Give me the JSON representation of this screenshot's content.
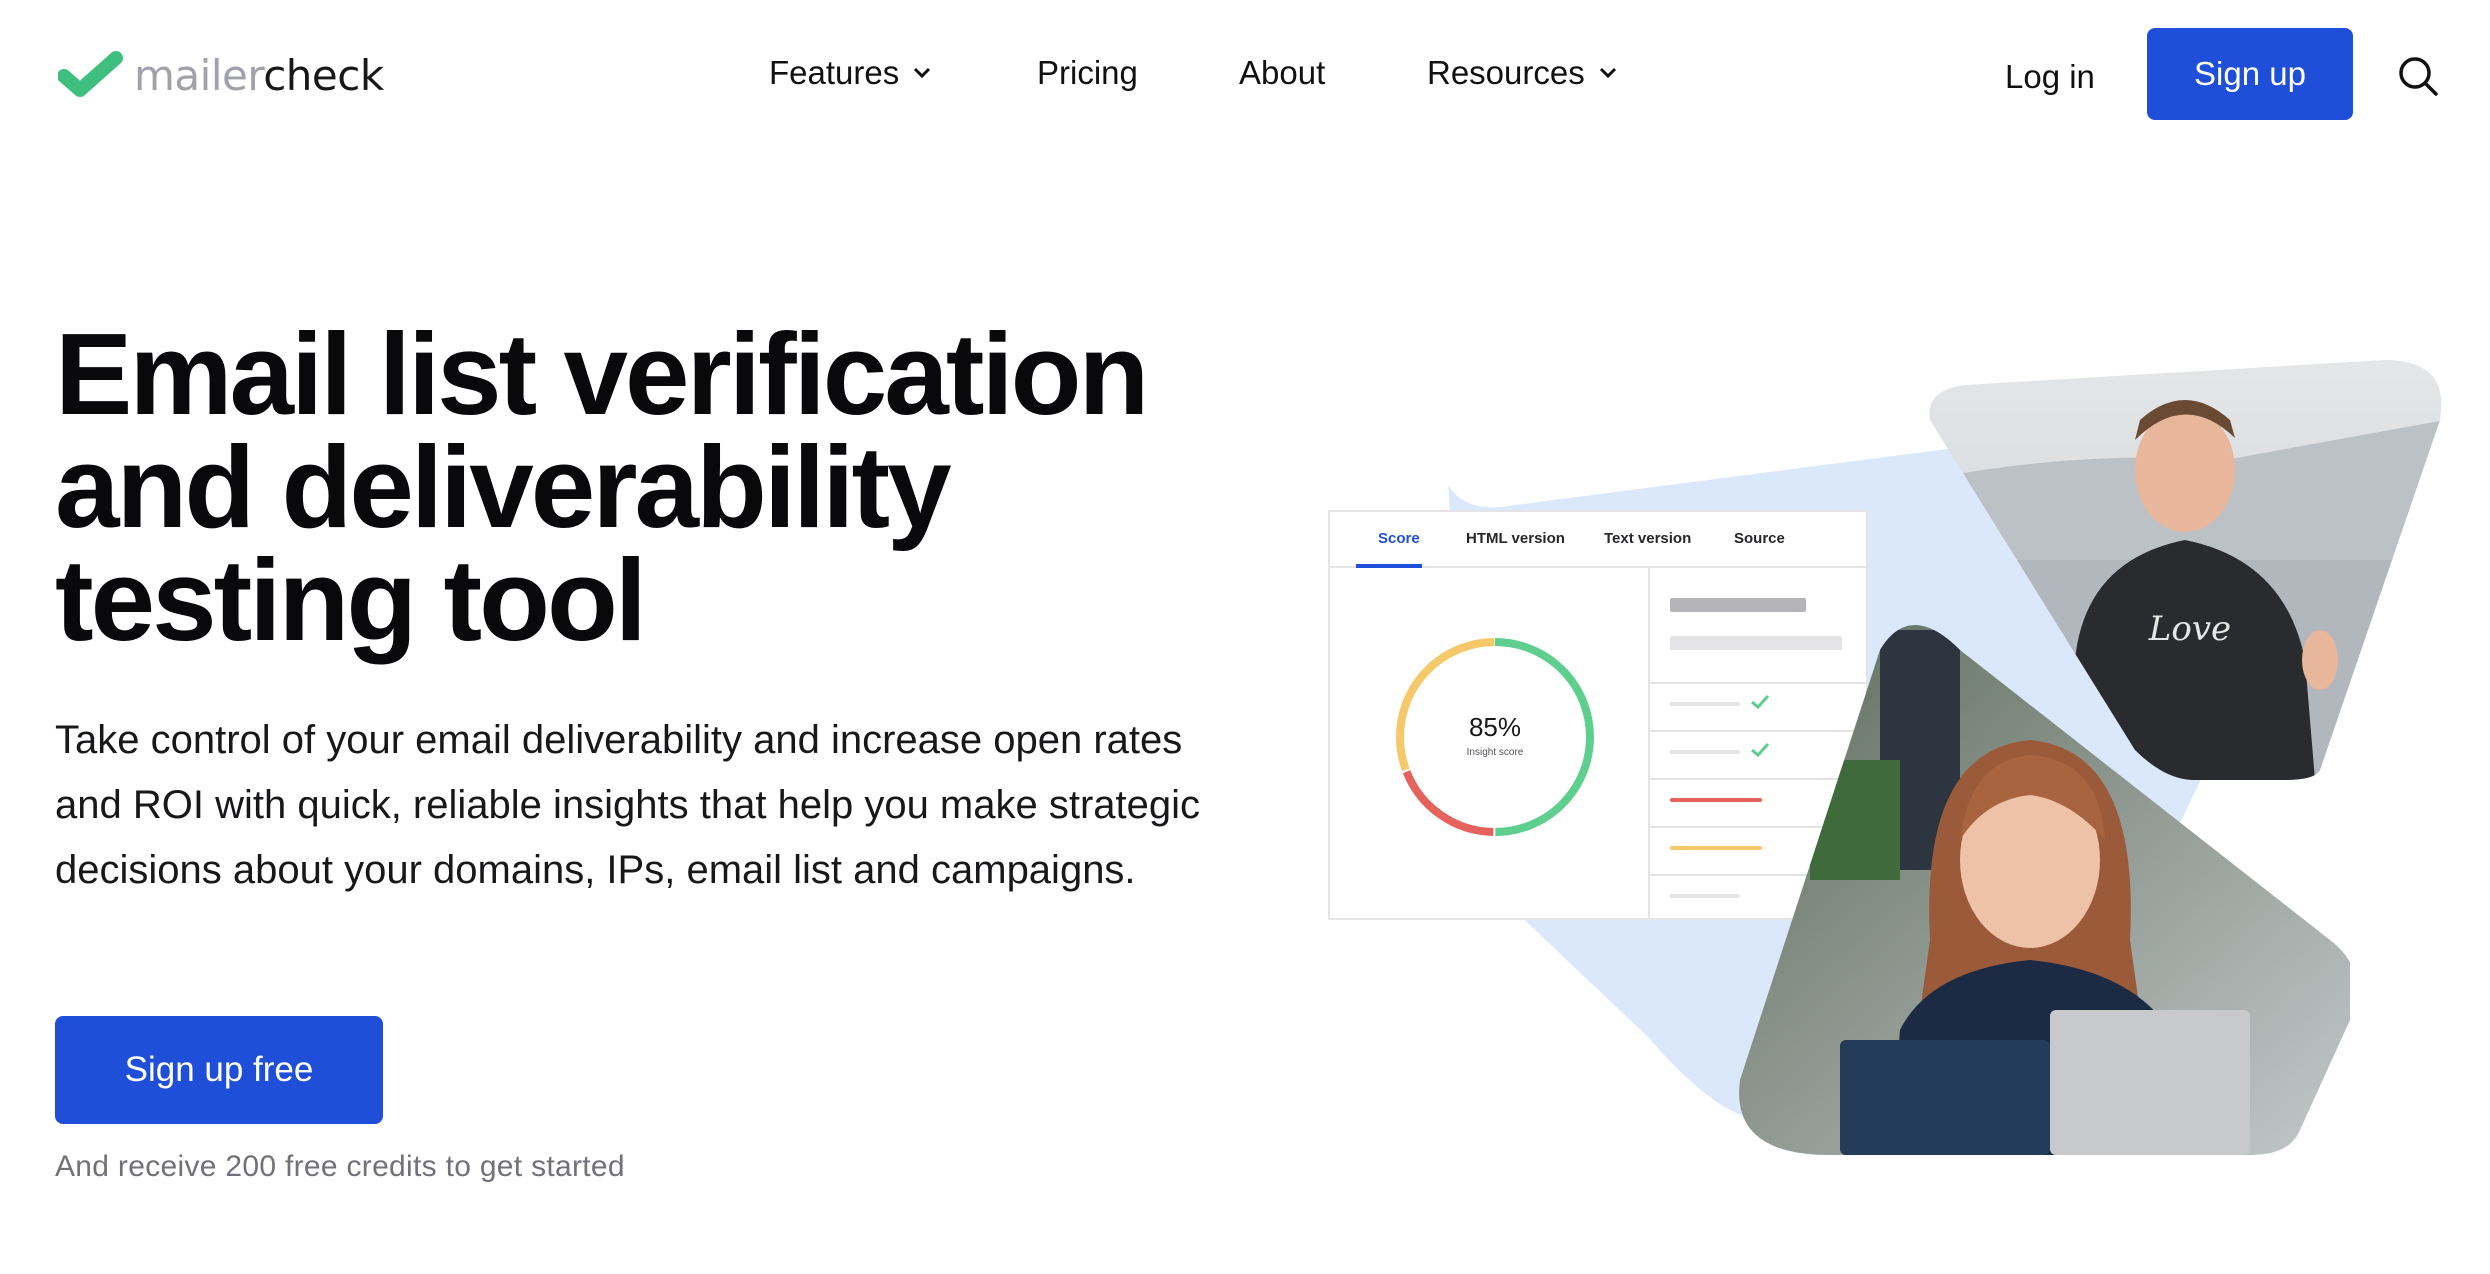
{
  "header": {
    "logo": {
      "light": "mailer",
      "dark": "check"
    },
    "nav": [
      {
        "label": "Features",
        "has_dropdown": true
      },
      {
        "label": "Pricing",
        "has_dropdown": false
      },
      {
        "label": "About",
        "has_dropdown": false
      },
      {
        "label": "Resources",
        "has_dropdown": true
      }
    ],
    "login_label": "Log in",
    "signup_label": "Sign up"
  },
  "hero": {
    "title_lines": [
      "Email list verification",
      "and deliverability",
      "testing tool"
    ],
    "description": "Take control of your email deliverability and increase open rates and ROI with quick, reliable insights that help you make strategic decisions about your domains, IPs, email list and campaigns.",
    "cta_label": "Sign up free",
    "cta_note": "And receive 200 free credits to get started"
  },
  "illustration": {
    "tabs": [
      "Score",
      "HTML version",
      "Text version",
      "Source"
    ],
    "active_tab": "Score",
    "score_value": "85%",
    "score_label": "Insight score"
  },
  "colors": {
    "brand_blue": "#1f4fd9",
    "logo_green": "#3fbf7f",
    "gauge_green": "#5fcf8f",
    "gauge_yellow": "#f5c96a",
    "gauge_red": "#e5625d",
    "shape_blue": "#dbe7fb"
  }
}
